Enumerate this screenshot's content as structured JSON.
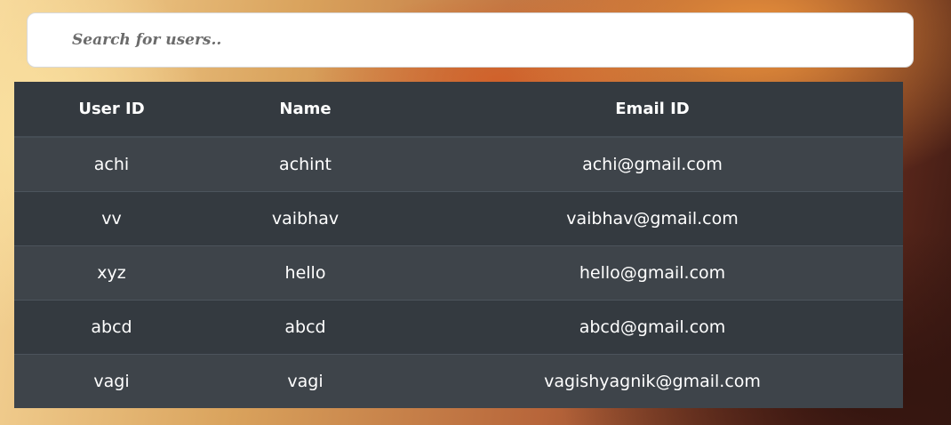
{
  "search": {
    "placeholder": "Search for users.."
  },
  "table": {
    "headers": {
      "user_id": "User ID",
      "name": "Name",
      "email": "Email ID"
    },
    "rows": [
      {
        "user_id": "achi",
        "name": "achint",
        "email": "achi@gmail.com"
      },
      {
        "user_id": "vv",
        "name": "vaibhav",
        "email": "vaibhav@gmail.com"
      },
      {
        "user_id": "xyz",
        "name": "hello",
        "email": "hello@gmail.com"
      },
      {
        "user_id": "abcd",
        "name": "abcd",
        "email": "abcd@gmail.com"
      },
      {
        "user_id": "vagi",
        "name": "vagi",
        "email": "vagishyagnik@gmail.com"
      }
    ]
  },
  "colors": {
    "table_dark": "#343a40",
    "table_stripe": "#3e444a",
    "text": "#ffffff"
  }
}
